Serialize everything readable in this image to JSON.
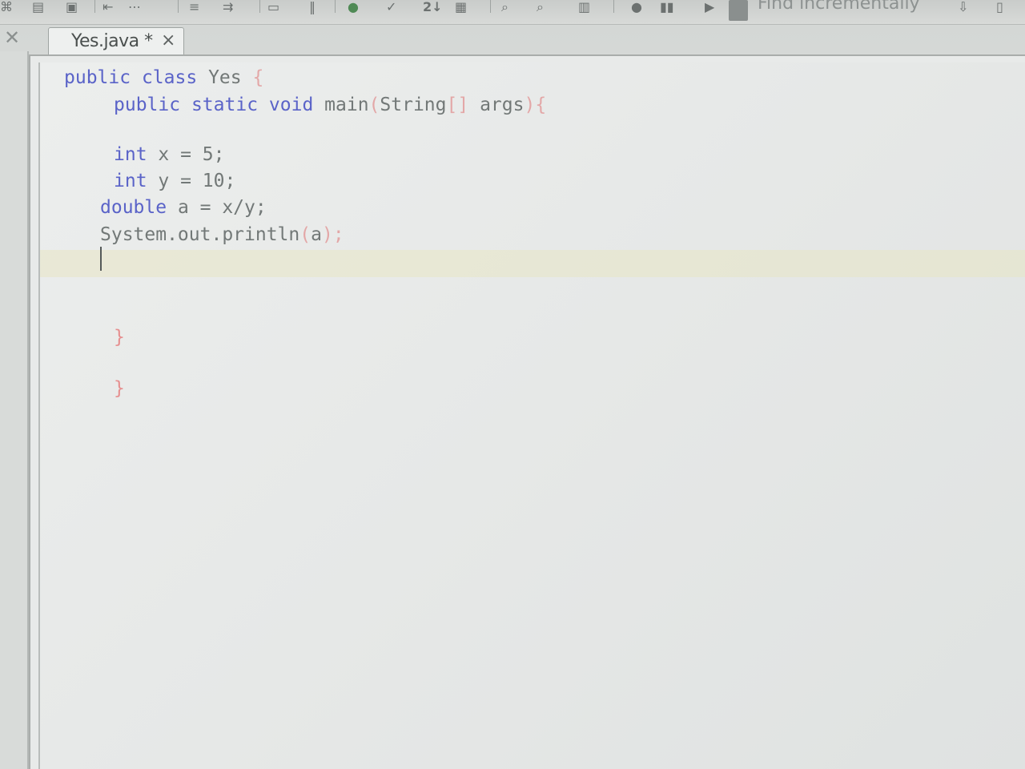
{
  "colors": {
    "keyword": "#5a63c8",
    "punctuation": "#e3a7a7",
    "identifier": "#727877",
    "brace": "#e68f8f",
    "current_line": "#e8e6c4"
  },
  "toolbar": {
    "find_label": "Find incrementally",
    "icons": [
      "go-icon",
      "paste-icon",
      "save-icon",
      "indent-icon",
      "format-icon",
      "comment-icon",
      "layout-icon",
      "run-icon",
      "check-icon",
      "sort-icon",
      "wizard-icon",
      "search-icon",
      "zoom-icon",
      "table-icon",
      "record-icon",
      "stop-icon",
      "play-icon",
      "find-menu-icon",
      "down-arrow-icon",
      "close-find-icon"
    ],
    "sort_label": "2↓"
  },
  "tab": {
    "label": "Yes.java *",
    "close": "×"
  },
  "editor": {
    "lines": [
      {
        "tokens": [
          {
            "t": "public",
            "c": "kw"
          },
          {
            "t": " "
          },
          {
            "t": "class",
            "c": "kw"
          },
          {
            "t": " "
          },
          {
            "t": "Yes",
            "c": "id"
          },
          {
            "t": " "
          },
          {
            "t": "{",
            "c": "punct"
          }
        ]
      },
      {
        "tokens": [
          {
            "t": "public",
            "c": "kw"
          },
          {
            "t": " "
          },
          {
            "t": "static",
            "c": "kw"
          },
          {
            "t": " "
          },
          {
            "t": "void",
            "c": "kw"
          },
          {
            "t": " "
          },
          {
            "t": "main",
            "c": "id"
          },
          {
            "t": "(",
            "c": "punct"
          },
          {
            "t": "String",
            "c": "id"
          },
          {
            "t": "[]",
            "c": "punct"
          },
          {
            "t": " "
          },
          {
            "t": "args",
            "c": "id"
          },
          {
            "t": ")",
            "c": "punct"
          },
          {
            "t": "{",
            "c": "punct"
          }
        ]
      },
      {
        "tokens": [
          {
            "t": "int",
            "c": "kw"
          },
          {
            "t": " x = 5;",
            "c": "id"
          }
        ]
      },
      {
        "tokens": [
          {
            "t": "int",
            "c": "kw"
          },
          {
            "t": " y = 10;",
            "c": "id"
          }
        ]
      },
      {
        "tokens": [
          {
            "t": "double",
            "c": "kw"
          },
          {
            "t": " a = x/y;",
            "c": "id"
          }
        ]
      },
      {
        "tokens": [
          {
            "t": "System.out.println",
            "c": "id"
          },
          {
            "t": "(",
            "c": "punct"
          },
          {
            "t": "a",
            "c": "id"
          },
          {
            "t": ")",
            "c": "punct"
          },
          {
            "t": ";",
            "c": "punct"
          }
        ]
      },
      {
        "tokens": [
          {
            "t": "}",
            "c": "brace"
          }
        ]
      },
      {
        "tokens": [
          {
            "t": "}",
            "c": "brace"
          }
        ]
      }
    ]
  }
}
